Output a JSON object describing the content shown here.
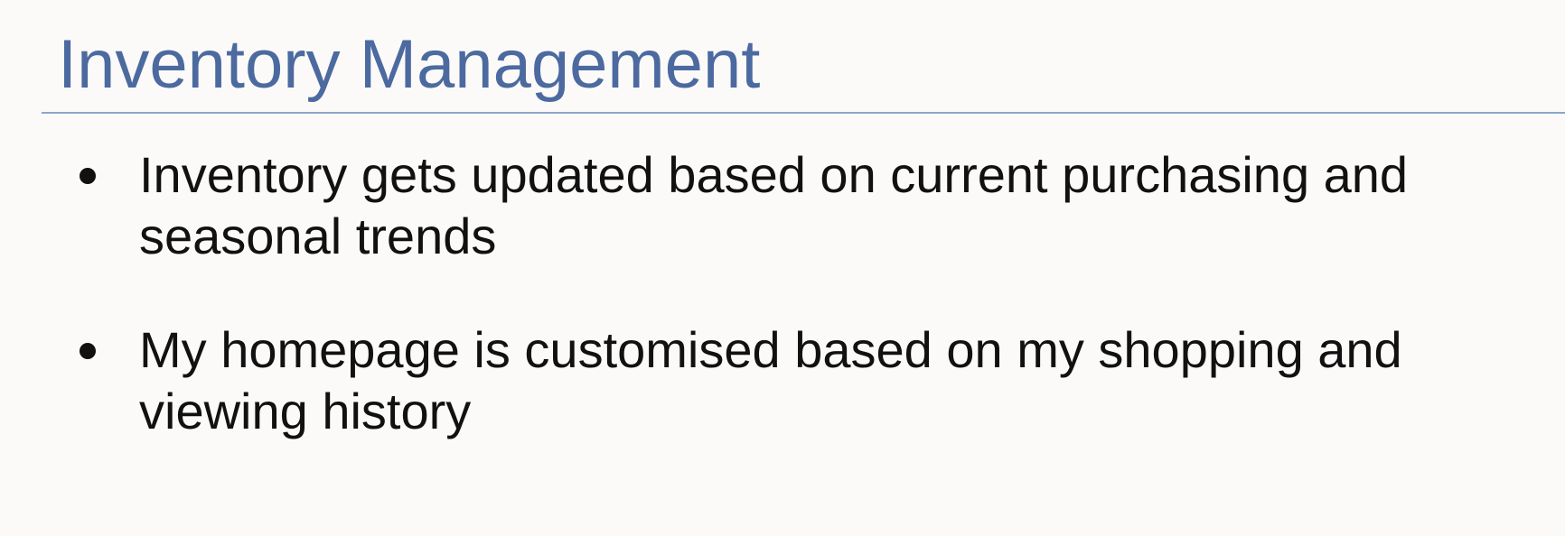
{
  "slide": {
    "title": "Inventory Management",
    "bullets": [
      {
        "text": "Inventory gets updated based on current purchasing and seasonal trends"
      },
      {
        "text": "My homepage is customised based on my shopping and viewing history"
      }
    ]
  },
  "colors": {
    "title": "#4c6aa0",
    "rule": "#8aa6cc",
    "background": "#fbfaf8",
    "body_text": "#111111"
  }
}
